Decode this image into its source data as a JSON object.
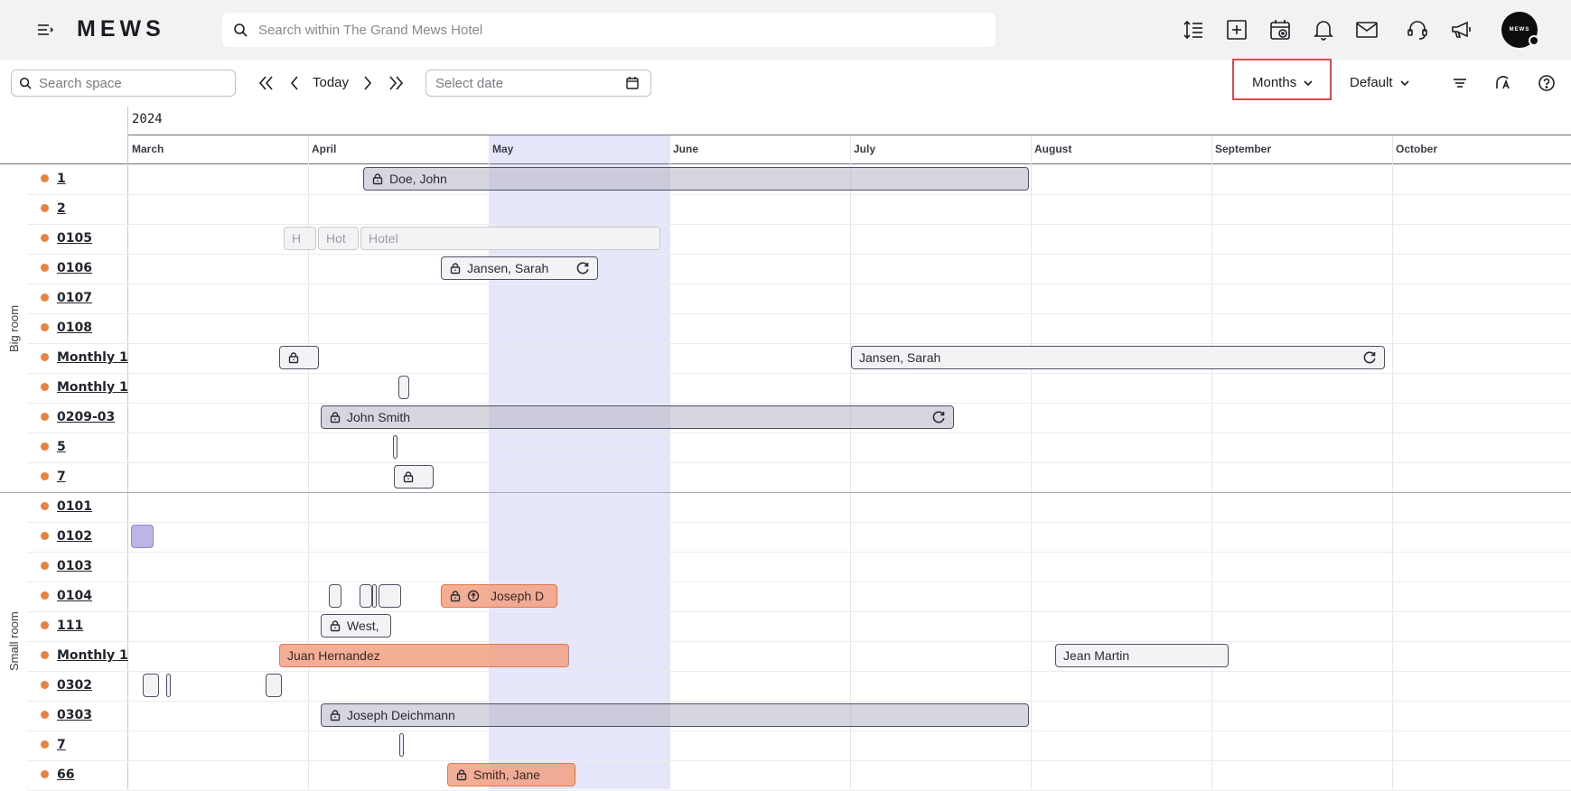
{
  "app": {
    "logo": "MEWS",
    "avatar_text": "MEWS"
  },
  "search": {
    "placeholder": "Search within The Grand Mews Hotel"
  },
  "toolbar": {
    "space_search_placeholder": "Search space",
    "today_label": "Today",
    "date_placeholder": "Select date",
    "view_mode": "Months",
    "view_preset": "Default"
  },
  "timeline": {
    "year": "2024",
    "months": [
      "March",
      "April",
      "May",
      "June",
      "July",
      "August",
      "September",
      "October"
    ],
    "selected_month": "May"
  },
  "groups": [
    {
      "name": "Big room",
      "rooms": [
        {
          "label": "1",
          "bookings": [
            {
              "text": "Doe, John",
              "style": "grey",
              "lock": true
            }
          ]
        },
        {
          "label": "2",
          "bookings": []
        },
        {
          "label": "0105",
          "bookings": [
            {
              "text": "H",
              "style": "ghost"
            },
            {
              "text": "Hot",
              "style": "ghost"
            },
            {
              "text": "Hotel",
              "style": "ghost"
            }
          ]
        },
        {
          "label": "0106",
          "bookings": [
            {
              "text": "Jansen, Sarah",
              "style": "light",
              "lock": true,
              "refresh": true
            }
          ]
        },
        {
          "label": "0107",
          "bookings": []
        },
        {
          "label": "0108",
          "bookings": []
        },
        {
          "label": "Monthly 1",
          "bookings": [
            {
              "text": "",
              "style": "light",
              "lock": true
            },
            {
              "text": "Jansen, Sarah",
              "style": "light",
              "refresh": true
            }
          ]
        },
        {
          "label": "Monthly 1",
          "bookings": [
            {
              "text": "",
              "style": "light"
            }
          ]
        },
        {
          "label": "0209-03",
          "bookings": [
            {
              "text": "John Smith",
              "style": "grey",
              "lock": true,
              "refresh": true
            }
          ]
        },
        {
          "label": "5",
          "bookings": [
            {
              "text": "",
              "style": "light"
            }
          ]
        },
        {
          "label": "7",
          "bookings": [
            {
              "text": "",
              "style": "light",
              "lock": true
            }
          ]
        }
      ]
    },
    {
      "name": "Small room",
      "rooms": [
        {
          "label": "0101",
          "bookings": []
        },
        {
          "label": "0102",
          "bookings": [
            {
              "text": "",
              "style": "purple"
            }
          ]
        },
        {
          "label": "0103",
          "bookings": []
        },
        {
          "label": "0104",
          "bookings": [
            {
              "text": "",
              "style": "light"
            },
            {
              "text": "",
              "style": "light"
            },
            {
              "text": "",
              "style": "light"
            },
            {
              "text": "",
              "style": "light"
            },
            {
              "text": "Joseph D",
              "style": "orange",
              "lock": true,
              "checkin": true
            }
          ]
        },
        {
          "label": "111",
          "bookings": [
            {
              "text": "West,",
              "style": "light",
              "lock": true
            }
          ]
        },
        {
          "label": "Monthly 1",
          "bookings": [
            {
              "text": "Juan Hernandez",
              "style": "orange"
            },
            {
              "text": "Jean Martin",
              "style": "light"
            }
          ]
        },
        {
          "label": "0302",
          "bookings": [
            {
              "text": "",
              "style": "light"
            },
            {
              "text": "",
              "style": "light"
            },
            {
              "text": "",
              "style": "light"
            }
          ]
        },
        {
          "label": "0303",
          "bookings": [
            {
              "text": "Joseph Deichmann",
              "style": "grey",
              "lock": true
            }
          ]
        },
        {
          "label": "7",
          "bookings": [
            {
              "text": "",
              "style": "light"
            }
          ]
        },
        {
          "label": "66",
          "bookings": [
            {
              "text": "Smith, Jane",
              "style": "orange",
              "lock": true
            }
          ]
        }
      ]
    }
  ],
  "colors": {
    "accent_highlight": "#e0474c",
    "room_dot": "#e9823f",
    "selected_month_band": "#e6e6fb"
  }
}
